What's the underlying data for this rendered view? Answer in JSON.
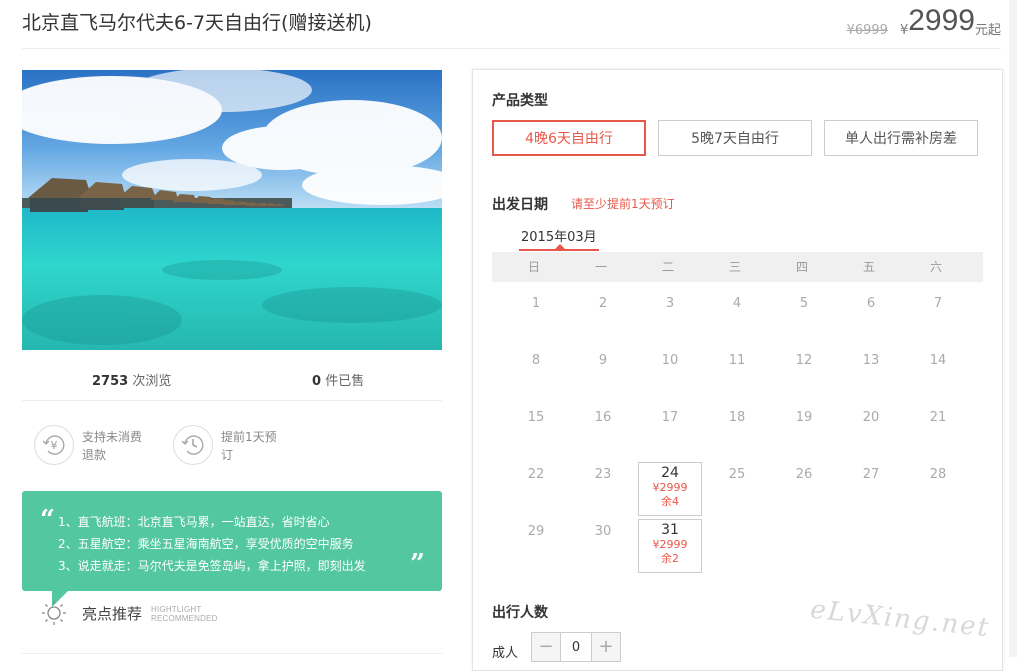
{
  "product": {
    "title": "北京直飞马尔代夫6-7天自由行(赠接送机)",
    "old_price": "¥6999",
    "currency": "¥",
    "price": "2999",
    "price_suffix": "元起"
  },
  "stats": {
    "views_count": "2753",
    "views_label": "次浏览",
    "sold_count": "0",
    "sold_label": "件已售"
  },
  "features": [
    {
      "icon": "refund-yen-icon",
      "line1": "支持未消费",
      "line2": "退款"
    },
    {
      "icon": "clock-history-icon",
      "line1": "提前1天预",
      "line2": "订"
    }
  ],
  "highlights": {
    "items": [
      "1、直飞航班：北京直飞马累，一站直达，省时省心",
      "2、五星航空：乘坐五星海南航空，享受优质的空中服务",
      "3、说走就走：马尔代夫是免签岛屿，拿上护照，即刻出发"
    ],
    "label": "亮点推荐",
    "label_en_1": "HIGHTLIGHT",
    "label_en_2": "RECOMMENDED",
    "color": "#52c7a0"
  },
  "booking": {
    "type_title": "产品类型",
    "types": [
      "4晚6天自由行",
      "5晚7天自由行",
      "单人出行需补房差"
    ],
    "selected_type": 0,
    "date_title": "出发日期",
    "date_note": "请至少提前1天预订",
    "month": "2015年03月",
    "weekdays": [
      "日",
      "一",
      "二",
      "三",
      "四",
      "五",
      "六"
    ],
    "weeks": [
      [
        "1",
        "2",
        "3",
        "4",
        "5",
        "6",
        "7"
      ],
      [
        "8",
        "9",
        "10",
        "11",
        "12",
        "13",
        "14"
      ],
      [
        "15",
        "16",
        "17",
        "18",
        "19",
        "20",
        "21"
      ],
      [
        "22",
        "23",
        "24",
        "25",
        "26",
        "27",
        "28"
      ],
      [
        "29",
        "30",
        "31",
        "",
        "",
        "",
        ""
      ]
    ],
    "available": [
      {
        "day": "24",
        "price": "¥2999",
        "remain": "余4"
      },
      {
        "day": "31",
        "price": "¥2999",
        "remain": "余2"
      }
    ],
    "people_title": "出行人数",
    "adult_label": "成人",
    "adult_count": "0",
    "minus": "−",
    "plus": "+",
    "accent": "#e8584a"
  },
  "watermark": "eLvXing.net"
}
